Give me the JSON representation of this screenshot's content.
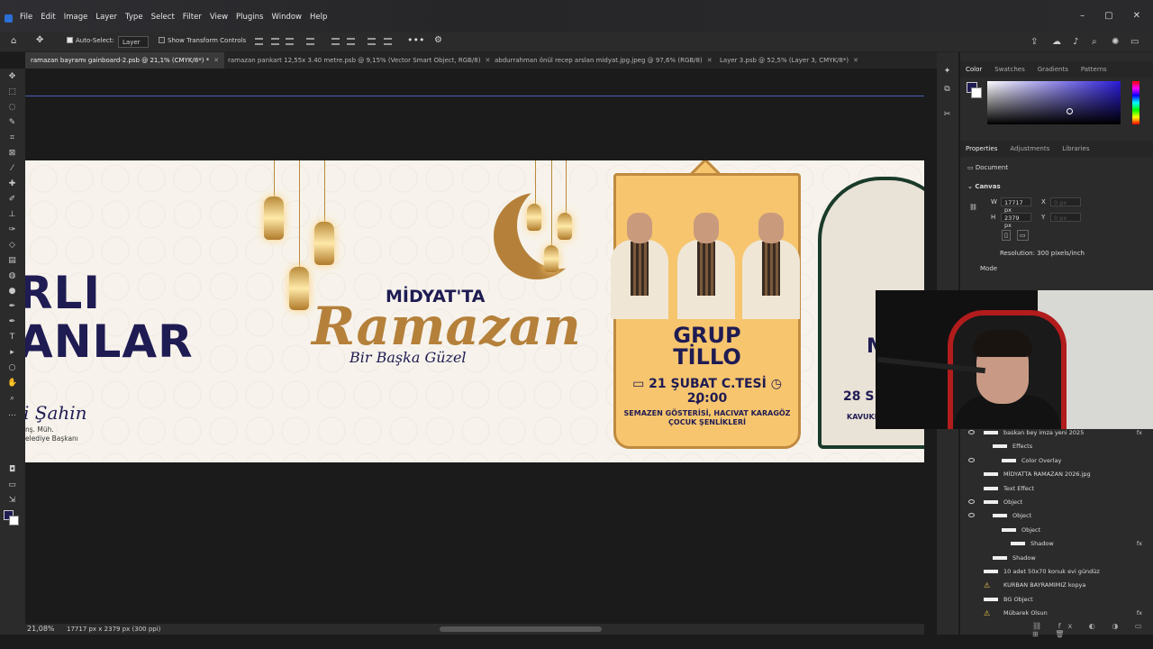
{
  "menu": [
    "File",
    "Edit",
    "Image",
    "Layer",
    "Type",
    "Select",
    "Filter",
    "View",
    "Plugins",
    "Window",
    "Help"
  ],
  "options": {
    "auto_select": "Auto-Select:",
    "layer_dropdown": "Layer",
    "show_transform": "Show Transform Controls"
  },
  "tabs": [
    {
      "label": "ramazan bayramı gainboard-2.psb @ 21,1% (CMYK/8*) *",
      "active": true
    },
    {
      "label": "ramazan pankart 12,55x 3.40 metre.psb @ 9,15% (Vector Smart Object, RGB/8)",
      "active": false
    },
    {
      "label": "abdurrahman önül recep arslan midyat.jpg.jpeg @ 97,6% (RGB/8)",
      "active": false
    },
    {
      "label": "Layer 3.psb @ 52,5% (Layer 3, CMYK/8*)",
      "active": false
    }
  ],
  "artboard": {
    "title_line1": "RLI",
    "title_line2": "ANLAR",
    "signature": "i Şahin",
    "sub1": "nş. Müh.",
    "sub2": "elediye Başkanı",
    "midyat": "MİDYAT'TA",
    "ramazan": "Ramazan",
    "tagline": "Bir Başka Güzel",
    "card_title": "GRUP\nTİLLO",
    "card_date": "21 ŞUBAT C.TESİ",
    "card_time": "20:00",
    "card_info": "SEMAZEN GÖSTERİSİ, HACIVAT KARAGÖZ\nÇOCUK ŞENLİKLERİ",
    "card2_big": "M",
    "card2_date": "28 S",
    "card2_place": "KAVUKL"
  },
  "status": {
    "zoom": "21,08%",
    "doc": "17717 px x 2379 px (300 ppi)"
  },
  "color_panel": {
    "tabs": [
      "Color",
      "Swatches",
      "Gradients",
      "Patterns"
    ],
    "fg_color": "#1f1b53"
  },
  "properties": {
    "tabs": [
      "Properties",
      "Adjustments",
      "Libraries"
    ],
    "document": "Document",
    "canvas_header": "Canvas",
    "w_label": "W",
    "w_value": "17717 px",
    "h_label": "H",
    "h_value": "2379 px",
    "x_label": "X",
    "x_value": "0 px",
    "y_label": "Y",
    "y_value": "0 px",
    "resolution": "Resolution: 300 pixels/inch",
    "mode": "Mode"
  },
  "layers": [
    {
      "name": "baskan bey imza yeni 2025",
      "eye": true,
      "fx": true,
      "indent": 0
    },
    {
      "name": "Effects",
      "eye": false,
      "fx": false,
      "indent": 1
    },
    {
      "name": "Color Overlay",
      "eye": true,
      "fx": false,
      "indent": 2
    },
    {
      "name": "MİDYATTA RAMAZAN 2026.jpg",
      "eye": false,
      "fx": false,
      "indent": 0
    },
    {
      "name": "Text Effect",
      "eye": false,
      "fx": false,
      "indent": 0
    },
    {
      "name": "Object",
      "eye": true,
      "fx": false,
      "indent": 0
    },
    {
      "name": "Object",
      "eye": true,
      "fx": false,
      "indent": 1
    },
    {
      "name": "Object",
      "eye": false,
      "fx": false,
      "indent": 2
    },
    {
      "name": "Shadow",
      "eye": false,
      "fx": true,
      "indent": 3
    },
    {
      "name": "Shadow",
      "eye": false,
      "fx": false,
      "indent": 1
    },
    {
      "name": "10 adet 50x70 konuk evi gündüz",
      "eye": false,
      "fx": false,
      "indent": 0
    },
    {
      "name": "KURBAN BAYRAMIMIZ kopya",
      "eye": false,
      "fx": false,
      "indent": 0,
      "warn": true
    },
    {
      "name": "BG Object",
      "eye": false,
      "fx": false,
      "indent": 0
    },
    {
      "name": "Mübarek Olsun",
      "eye": false,
      "fx": true,
      "indent": 0,
      "warn": true
    }
  ]
}
